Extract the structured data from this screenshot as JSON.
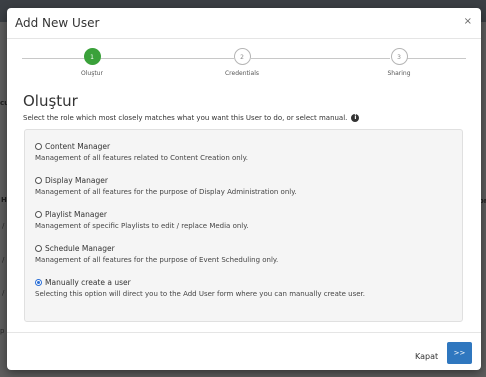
{
  "background": {
    "fragments": [
      "H",
      "/",
      "/",
      "/",
      "cu",
      "or",
      "p"
    ]
  },
  "modal": {
    "title": "Add New User",
    "close_label": "×",
    "steps": [
      {
        "number": "1",
        "label": "Oluştur",
        "active": true
      },
      {
        "number": "2",
        "label": "Credentials",
        "active": false
      },
      {
        "number": "3",
        "label": "Sharing",
        "active": false
      }
    ],
    "section_title": "Oluştur",
    "section_description": "Select the role which most closely matches what you want this User to do, or select manual.",
    "info_icon_glyph": "i",
    "options": [
      {
        "label": "Content Manager",
        "description": "Management of all features related to Content Creation only.",
        "checked": false
      },
      {
        "label": "Display Manager",
        "description": "Management of all features for the purpose of Display Administration only.",
        "checked": false
      },
      {
        "label": "Playlist Manager",
        "description": "Management of specific Playlists to edit / replace Media only.",
        "checked": false
      },
      {
        "label": "Schedule Manager",
        "description": "Management of all features for the purpose of Event Scheduling only.",
        "checked": false
      },
      {
        "label": "Manually create a user",
        "description": "Selecting this option will direct you to the Add User form where you can manually create user.",
        "checked": true
      }
    ],
    "footer": {
      "close_label": "Kapat",
      "next_label": ">>"
    }
  },
  "colors": {
    "accent": "#2f77bf",
    "step_active": "#3aa13a"
  }
}
